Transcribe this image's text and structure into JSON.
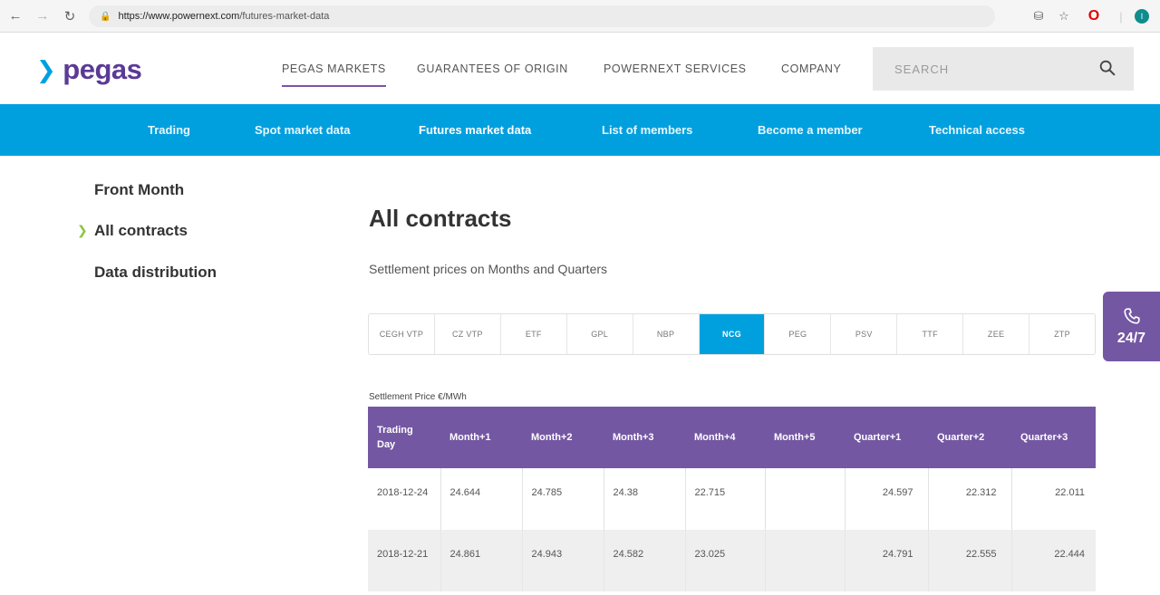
{
  "browser": {
    "url_scheme_host": "https://www.powernext.com",
    "url_path": "/futures-market-data",
    "profile_initial": "I"
  },
  "header": {
    "logo_text": "pegas",
    "nav": [
      "PEGAS MARKETS",
      "GUARANTEES OF ORIGIN",
      "POWERNEXT SERVICES",
      "COMPANY"
    ],
    "active_nav": "PEGAS MARKETS",
    "search_placeholder": "SEARCH"
  },
  "subnav": {
    "items": [
      "Trading",
      "Spot market data",
      "Futures market data",
      "List of members",
      "Become a member",
      "Technical access"
    ],
    "current": "Futures market data"
  },
  "sidebar": {
    "items": [
      "Front Month",
      "All contracts",
      "Data distribution"
    ],
    "current": "All contracts"
  },
  "main": {
    "title": "All contracts",
    "subtitle": "Settlement prices on Months and Quarters",
    "hubs": [
      "CEGH VTP",
      "CZ VTP",
      "ETF",
      "GPL",
      "NBP",
      "NCG",
      "PEG",
      "PSV",
      "TTF",
      "ZEE",
      "ZTP"
    ],
    "active_hub": "NCG",
    "table_caption": "Settlement Price €/MWh",
    "table": {
      "headers": [
        "Trading Day",
        "Month+1",
        "Month+2",
        "Month+3",
        "Month+4",
        "Month+5",
        "Quarter+1",
        "Quarter+2",
        "Quarter+3"
      ],
      "rows": [
        [
          "2018-12-24",
          "24.644",
          "24.785",
          "24.38",
          "22.715",
          "",
          "24.597",
          "22.312",
          "22.011"
        ],
        [
          "2018-12-21",
          "24.861",
          "24.943",
          "24.582",
          "23.025",
          "",
          "24.791",
          "22.555",
          "22.444"
        ]
      ]
    }
  },
  "support": {
    "label": "24/7"
  },
  "colors": {
    "purple": "#7457a3",
    "blue": "#00a0df",
    "lime": "#8cc63f"
  }
}
